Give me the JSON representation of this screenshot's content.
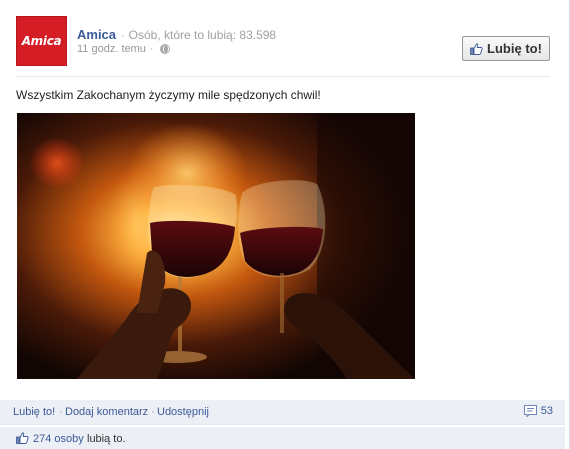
{
  "page": {
    "name": "Amica",
    "logo_text": "Amica",
    "fans_text": "Osób, które to lubią: 83.598",
    "timestamp": "11 godz. temu",
    "like_button_label": "Lubię to!"
  },
  "post": {
    "message": "Wszystkim Zakochanym życzymy mile spędzonych chwil!",
    "photo_alt": "two glasses of red wine in front of fire"
  },
  "actions": {
    "like": "Lubię to!",
    "comment": "Dodaj komentarz",
    "share": "Udostępnij",
    "comment_count": "53"
  },
  "likes": {
    "link_text": "274 osoby",
    "suffix": "lubią to."
  },
  "colors": {
    "link": "#3b5998",
    "brand_red": "#d41d24",
    "bar_bg": "#eceff5"
  }
}
